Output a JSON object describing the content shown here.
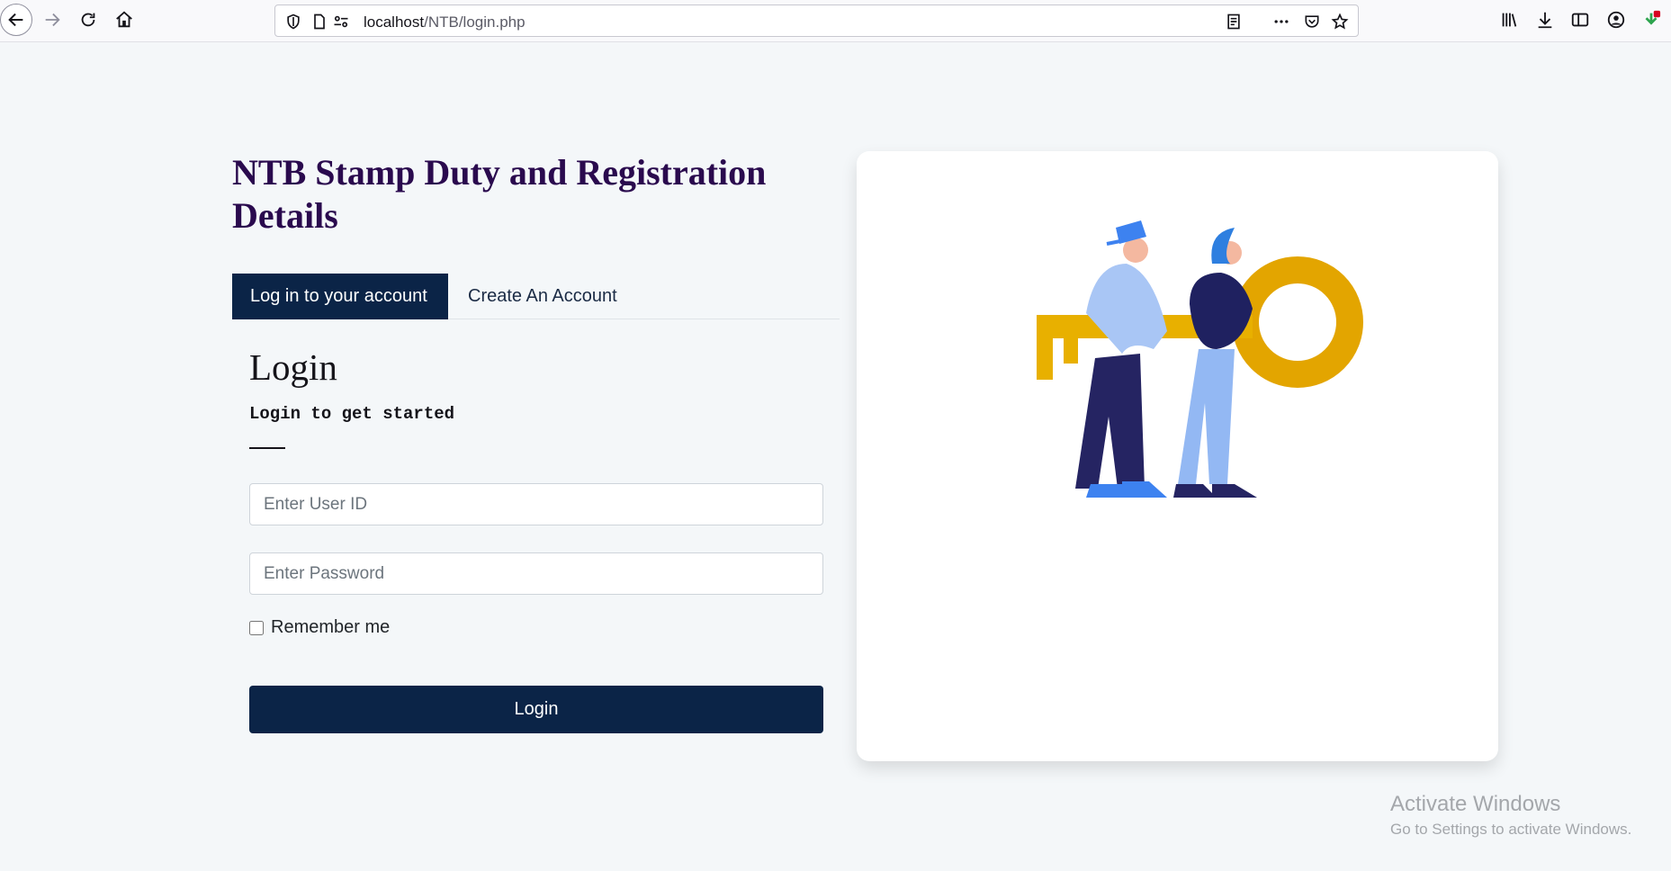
{
  "browser": {
    "url_host": "localhost",
    "url_path": "/NTB/login.php",
    "icons": [
      "back-icon",
      "forward-icon",
      "reload-icon",
      "home-icon",
      "shield-icon",
      "page-icon",
      "permissions-icon",
      "reader-view-icon",
      "more-icon",
      "pocket-icon",
      "bookmark-star-icon",
      "library-icon",
      "download-icon",
      "sidebar-icon",
      "account-icon",
      "extension-download-icon"
    ]
  },
  "page": {
    "title": "NTB Stamp Duty and Registration Details",
    "tabs": [
      {
        "label": "Log in to your account",
        "active": true
      },
      {
        "label": "Create An Account",
        "active": false
      }
    ],
    "login": {
      "heading": "Login",
      "subheading": "Login to get started",
      "user_placeholder": "Enter User ID",
      "password_placeholder": "Enter Password",
      "remember_label": "Remember me",
      "button_label": "Login"
    }
  },
  "watermark": {
    "line1": "Activate Windows",
    "line2": "Go to Settings to activate Windows."
  },
  "colors": {
    "primary": "#0b2447",
    "title": "#2a0a4e",
    "key": "#e8a900"
  }
}
